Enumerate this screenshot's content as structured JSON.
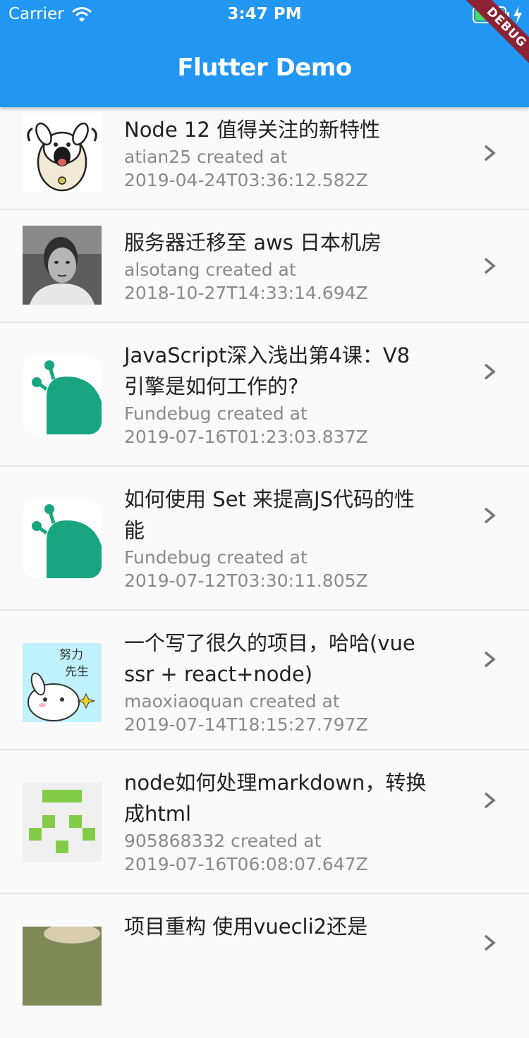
{
  "status_bar": {
    "carrier": "Carrier",
    "time": "3:47 PM"
  },
  "app_bar": {
    "title": "Flutter Demo",
    "debug_banner": "DEBUG"
  },
  "colors": {
    "primary": "#2196f3",
    "debug_banner": "#8b2335",
    "battery": "#4cd964"
  },
  "items": [
    {
      "title_lines": [
        "Node 12 值得关注的新特性"
      ],
      "author_line": "atian25 created at",
      "date": "2019-04-24T03:36:12.582Z",
      "avatar": "cartoon-dog-avatar"
    },
    {
      "title_lines": [
        "服务器迁移至 aws 日本机房"
      ],
      "author_line": "alsotang created at",
      "date": "2018-10-27T14:33:14.694Z",
      "avatar": "photo-avatar"
    },
    {
      "title_lines": [
        "JavaScript深入浅出第4课：V8",
        "引擎是如何工作的?"
      ],
      "author_line": "Fundebug created at",
      "date": "2019-07-16T01:23:03.837Z",
      "avatar": "fundebug-logo-avatar"
    },
    {
      "title_lines": [
        "如何使用 Set 来提高JS代码的性",
        "能"
      ],
      "author_line": "Fundebug created at",
      "date": "2019-07-12T03:30:11.805Z",
      "avatar": "fundebug-logo-avatar"
    },
    {
      "title_lines": [
        "一个写了很久的项目，哈哈(vue",
        "ssr + react+node)"
      ],
      "author_line": "maoxiaoquan created at",
      "date": "2019-07-14T18:15:27.797Z",
      "avatar": "rabbit-cartoon-avatar",
      "avatar_text": [
        "努力",
        "先生"
      ]
    },
    {
      "title_lines": [
        "node如何处理markdown，转换",
        "成html"
      ],
      "author_line": "905868332 created at",
      "date": "2019-07-16T06:08:07.647Z",
      "avatar": "identicon-avatar"
    },
    {
      "title_lines": [
        "项目重构 使用vuecli2还是"
      ],
      "author_line": "",
      "date": "",
      "avatar": "photo-avatar"
    }
  ]
}
